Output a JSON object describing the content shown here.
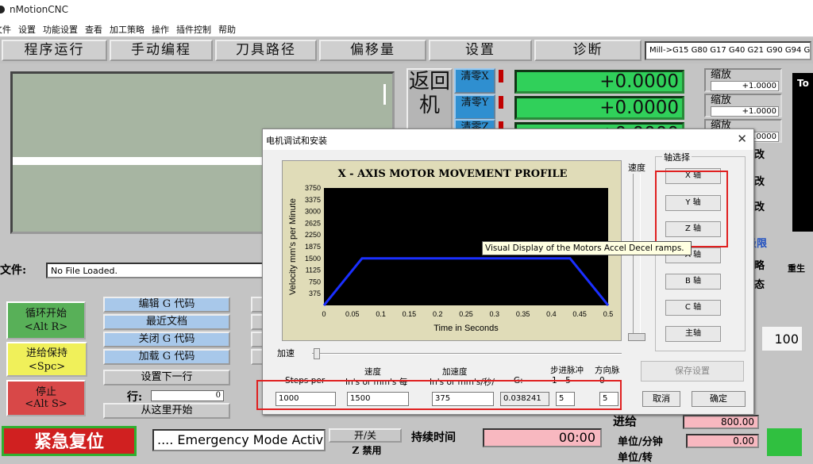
{
  "app": {
    "title": "nMotionCNC"
  },
  "menu": [
    "文件",
    "设置",
    "功能设置",
    "查看",
    "加工策略",
    "操作",
    "插件控制",
    "帮助"
  ],
  "tabs": [
    "程序运行",
    "手动编程",
    "刀具路径",
    "偏移量",
    "设置",
    "诊断"
  ],
  "gcodes": "Mill->G15  G80 G17 G40 G21 G90 G94 G54 G49",
  "ref_button": "返回机",
  "axes": [
    {
      "clear": "清零X",
      "value": "+0.0000",
      "scale_label": "缩放",
      "scale": "+1.0000"
    },
    {
      "clear": "清零Y",
      "value": "+0.0000",
      "scale_label": "缩放",
      "scale": "+1.0000"
    },
    {
      "clear": "清零Z",
      "value": "+0.0000",
      "scale_label": "缩放",
      "scale": "+1.0000"
    }
  ],
  "right_partial": [
    "改",
    "改",
    "改",
    "极限",
    "略",
    "态",
    "重生"
  ],
  "tool_label": "To",
  "file": {
    "label": "文件:",
    "value": "No File Loaded."
  },
  "cycle_buttons": {
    "start": "循环开始",
    "start_key": "<Alt R>",
    "hold": "进给保持",
    "hold_key": "<Spc>",
    "stop": "停止",
    "stop_key": "<Alt S>"
  },
  "gcode_buttons": [
    "编辑 G 代码",
    "最近文档",
    "关闭 G 代码",
    "加载 G 代码",
    "设置下一行"
  ],
  "line_label": "行:",
  "line_value": "0",
  "run_from_here": "从这里开始",
  "emergency": {
    "button": "紧急复位",
    "status": ".... Emergency Mode Active ....",
    "on_off": "开/关",
    "ban": "Z 禁用"
  },
  "bottom": {
    "duration_label": "持续时间",
    "duration_value": "00:00",
    "feed_label": "进给",
    "feed_value": "800.00",
    "unit_label": "单位/分钟",
    "unit_value": "0.00",
    "rev_label": "单位/转",
    "hundred": "100"
  },
  "dialog": {
    "title": "电机调试和安装",
    "speed_label": "速度",
    "accel_label": "加速",
    "axis_group": "轴选择",
    "axis_buttons": [
      "X 轴",
      "Y 轴",
      "Z 轴",
      "A 轴",
      "B 轴",
      "C 轴",
      "主轴"
    ],
    "tooltip": "Visual Display of the Motors Accel  Decel ramps.",
    "save": "保存设置",
    "cancel": "取消",
    "ok": "确定",
    "fields": [
      {
        "top": "",
        "sub": "Steps per",
        "value": "1000"
      },
      {
        "top": "速度",
        "sub": "In's or mm's 每",
        "value": "1500"
      },
      {
        "top": "加速度",
        "sub": "In's or mm's/秒/",
        "value": "375"
      },
      {
        "top": "",
        "sub": "G:",
        "value": "0.038241"
      },
      {
        "top": "步进脉冲",
        "sub": "1 - 5",
        "value": "5"
      },
      {
        "top": "方向脉",
        "sub": "0 -",
        "value": "5"
      }
    ]
  },
  "chart_data": {
    "type": "line",
    "title": "X - AXIS MOTOR MOVEMENT PROFILE",
    "xlabel": "Time in Seconds",
    "ylabel": "Velocity mm's per Minute",
    "xlim": [
      0,
      0.5
    ],
    "ylim": [
      0,
      3750
    ],
    "xticks": [
      "0",
      "0.05",
      "0.1",
      "0.15",
      "0.2",
      "0.25",
      "0.3",
      "0.35",
      "0.4",
      "0.45",
      "0.5"
    ],
    "yticks": [
      "375",
      "750",
      "1125",
      "1500",
      "1875",
      "2250",
      "2625",
      "3000",
      "3375",
      "3750"
    ],
    "series": [
      {
        "x": [
          0,
          0.067,
          0.433,
          0.5
        ],
        "y": [
          0,
          1500,
          1500,
          0
        ],
        "color": "#1a2fff"
      }
    ]
  }
}
